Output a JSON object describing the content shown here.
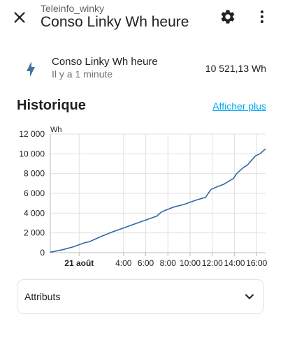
{
  "header": {
    "subtitle": "Teleinfo_winky",
    "title": "Conso Linky Wh heure"
  },
  "entity": {
    "name": "Conso Linky Wh heure",
    "last_changed": "Il y a 1 minute",
    "state": "10 521,13 Wh",
    "icon": "flash-icon"
  },
  "history": {
    "title": "Historique",
    "show_more": "Afficher plus"
  },
  "attributes": {
    "label": "Attributs"
  },
  "colors": {
    "accent": "#03a9f4",
    "line": "#3366aa",
    "icon": "#44739e"
  },
  "chart_data": {
    "type": "line",
    "title": "",
    "ylabel": "Wh",
    "xlabel": "",
    "ylim": [
      0,
      12000
    ],
    "yticks": [
      0,
      2000,
      4000,
      6000,
      8000,
      10000,
      12000
    ],
    "ytick_labels": [
      "0",
      "2 000",
      "4 000",
      "6 000",
      "8 000",
      "10 000",
      "12 000"
    ],
    "xlim": [
      -2.6,
      16.8
    ],
    "xticks": [
      0,
      4,
      6,
      8,
      10,
      12,
      14,
      16
    ],
    "xtick_labels": [
      "21 août",
      "4:00",
      "6:00",
      "8:00",
      "10:00",
      "12:00",
      "14:00",
      "16:00"
    ],
    "grid": true,
    "series": [
      {
        "name": "",
        "x": [
          -2.6,
          -1.5,
          -0.5,
          0.5,
          0.9,
          1.3,
          2.0,
          3.0,
          4.0,
          5.0,
          6.0,
          7.0,
          7.4,
          7.8,
          8.5,
          9.5,
          10.5,
          11.4,
          11.7,
          11.9,
          12.5,
          13.0,
          13.6,
          13.9,
          14.2,
          14.4,
          14.8,
          15.2,
          15.5,
          15.9,
          16.3,
          16.6,
          16.8
        ],
        "y": [
          50,
          300,
          600,
          1000,
          1100,
          1300,
          1650,
          2100,
          2500,
          2900,
          3300,
          3700,
          4100,
          4300,
          4600,
          4900,
          5300,
          5600,
          6100,
          6400,
          6700,
          6900,
          7300,
          7500,
          8000,
          8200,
          8600,
          8900,
          9300,
          9800,
          10000,
          10300,
          10500
        ]
      }
    ]
  }
}
